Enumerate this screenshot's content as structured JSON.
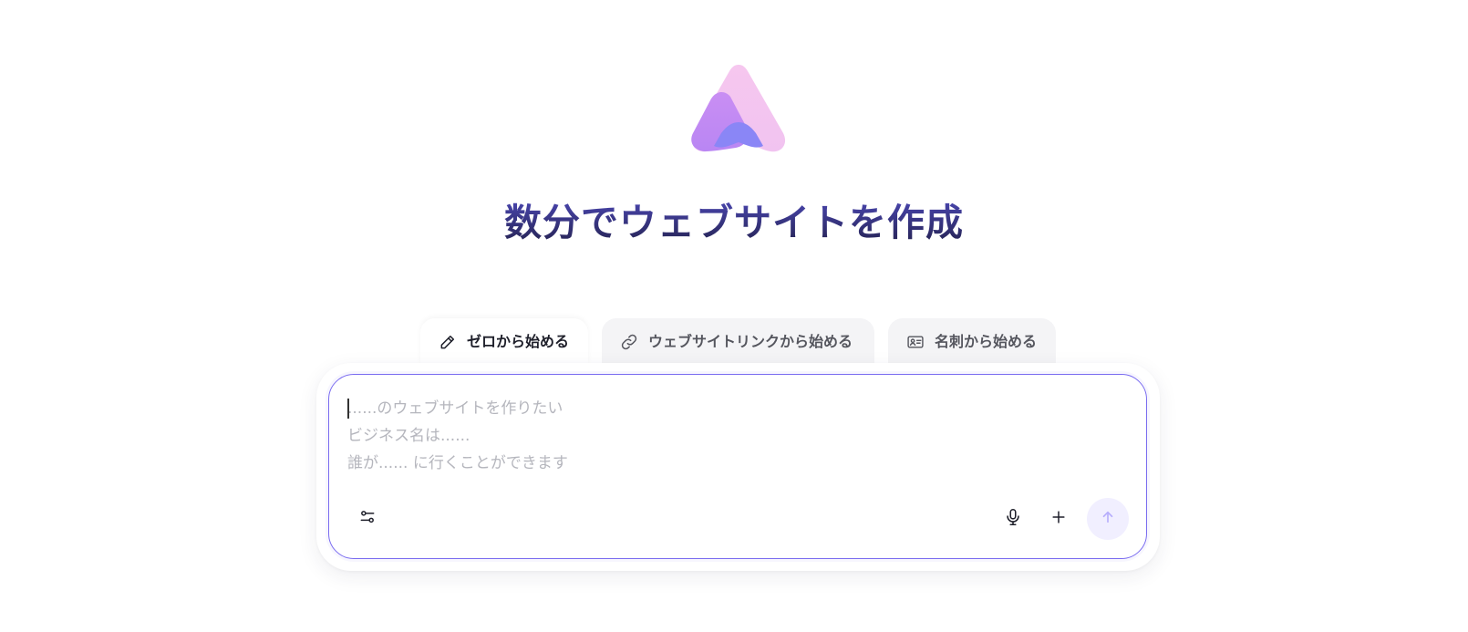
{
  "hero": {
    "title": "数分でウェブサイトを作成"
  },
  "tabs": [
    {
      "label": "ゼロから始める",
      "icon": "pencil-icon",
      "active": true
    },
    {
      "label": "ウェブサイトリンクから始める",
      "icon": "link-icon",
      "active": false
    },
    {
      "label": "名刺から始める",
      "icon": "id-card-icon",
      "active": false
    }
  ],
  "prompt": {
    "placeholder": "......のウェブサイトを作りたい\nビジネス名は......\n誰が...... に行くことができます",
    "value": ""
  },
  "toolbar": {
    "settings_icon": "sliders-icon",
    "mic_icon": "microphone-icon",
    "add_icon": "plus-icon",
    "send_icon": "arrow-up-icon"
  },
  "colors": {
    "accent": "#7a6cf0",
    "title": "#35357a",
    "send_bg": "#f1efff",
    "send_icon": "#b7aefc"
  }
}
